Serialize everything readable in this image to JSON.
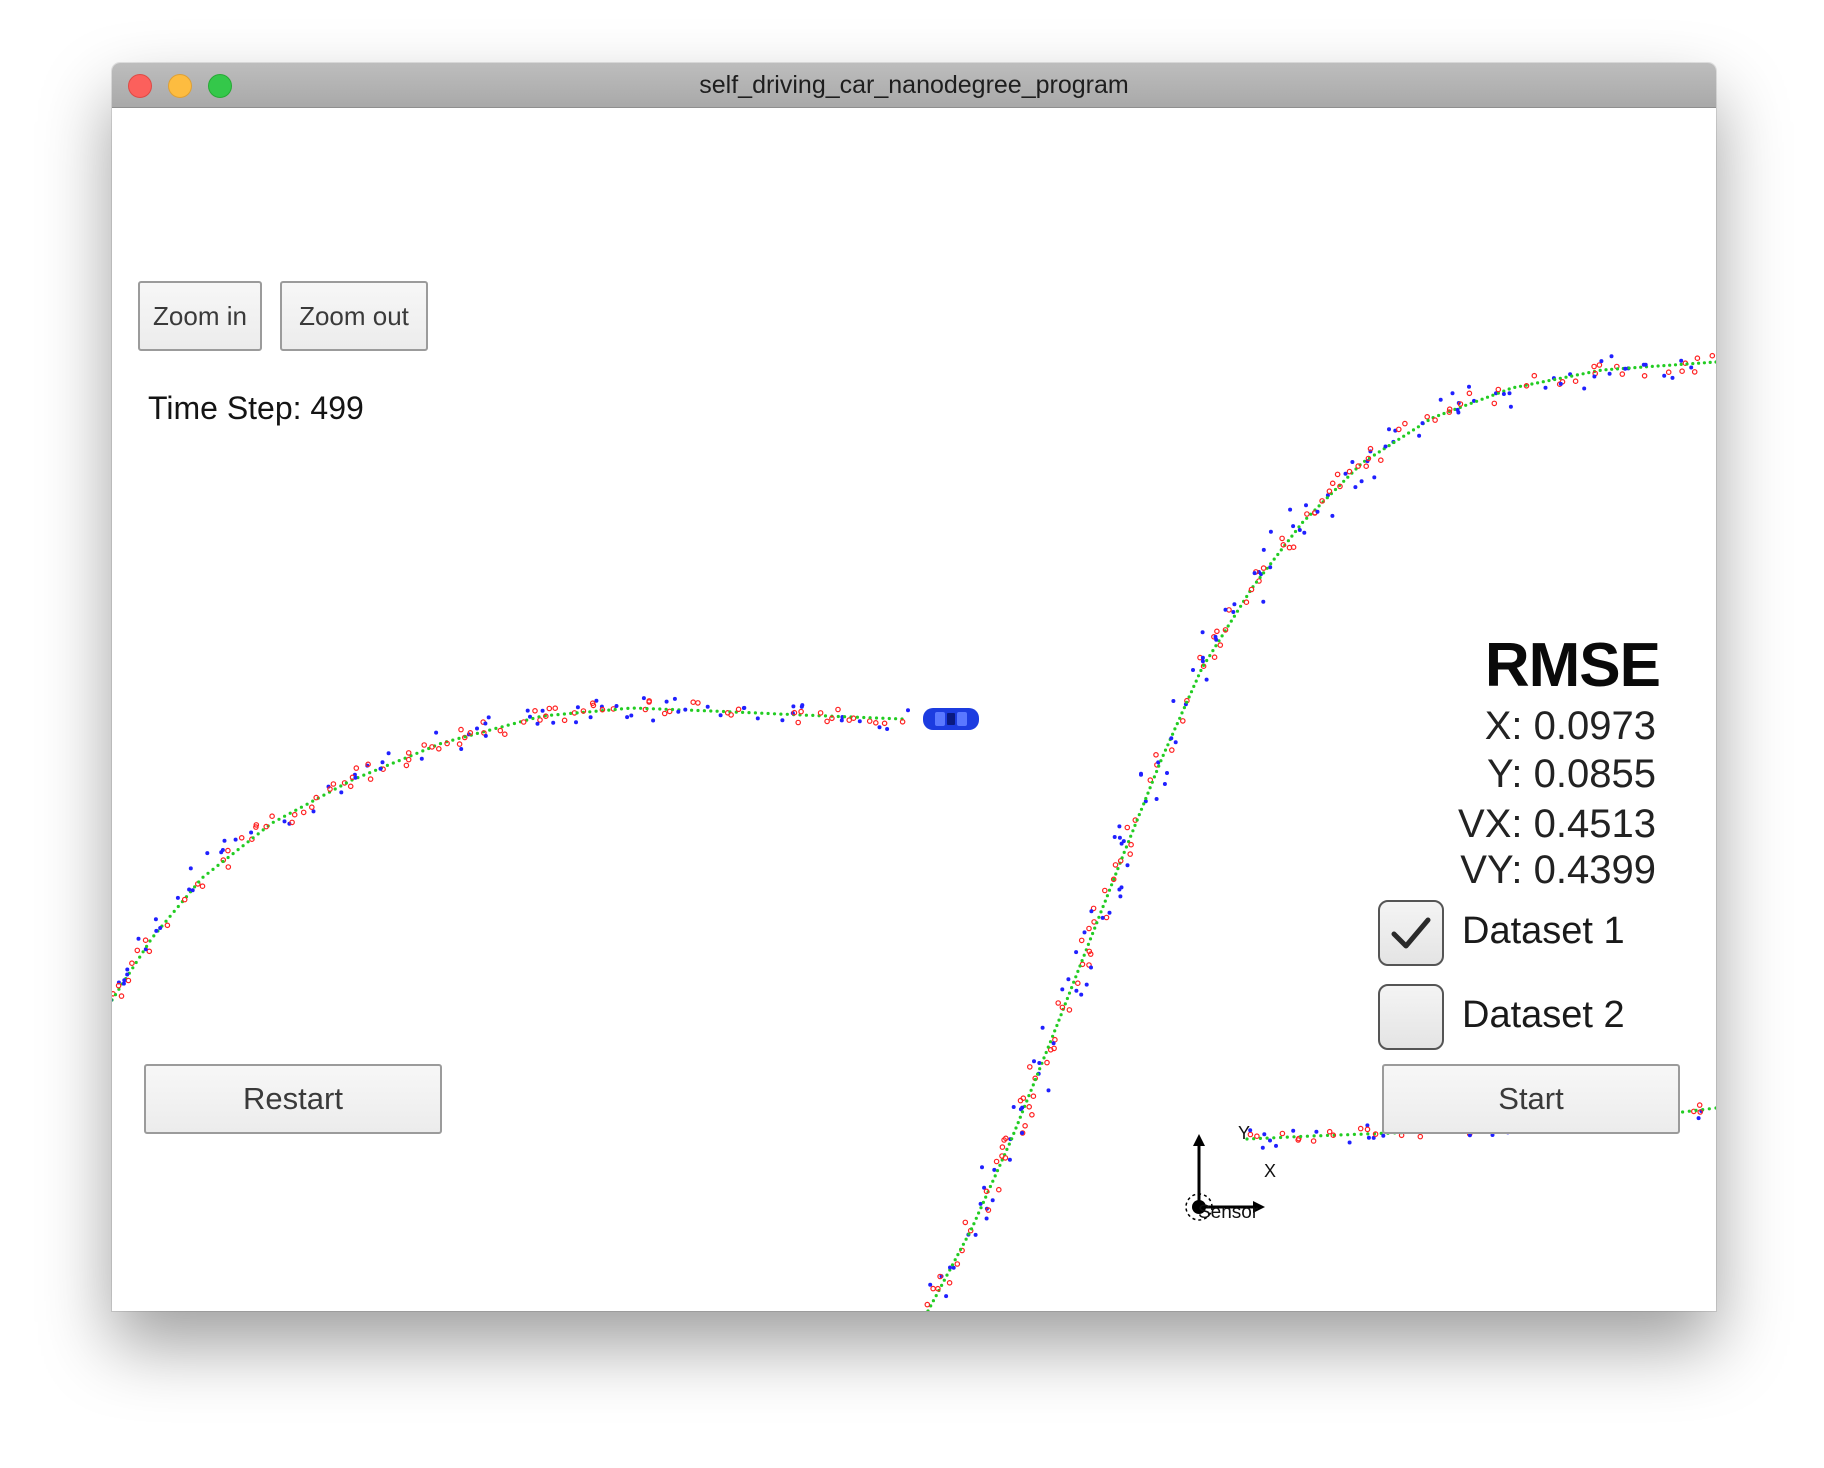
{
  "window": {
    "title": "self_driving_car_nanodegree_program"
  },
  "toolbar": {
    "zoom_in_label": "Zoom in",
    "zoom_out_label": "Zoom out"
  },
  "status": {
    "time_step_label": "Time Step:",
    "time_step_value": "499"
  },
  "rmse": {
    "title": "RMSE",
    "rows": [
      {
        "label": "X:",
        "value": "0.0973"
      },
      {
        "label": "Y:",
        "value": "0.0855"
      },
      {
        "label": "VX:",
        "value": "0.4513"
      },
      {
        "label": "VY:",
        "value": "0.4399"
      }
    ]
  },
  "datasets": [
    {
      "label": "Dataset 1",
      "checked": true
    },
    {
      "label": "Dataset 2",
      "checked": false
    }
  ],
  "controls": {
    "restart_label": "Restart",
    "start_label": "Start"
  },
  "sensor": {
    "label": "Sensor",
    "axis_x": "X",
    "axis_y": "Y"
  },
  "colors": {
    "ground_truth": "#22cc22",
    "radar": "#2020ff",
    "lidar": "#ff2020",
    "car": "#1c3ce0"
  },
  "icons": {
    "checkmark": "check-icon",
    "car": "car-icon",
    "sensor": "sensor-icon"
  }
}
